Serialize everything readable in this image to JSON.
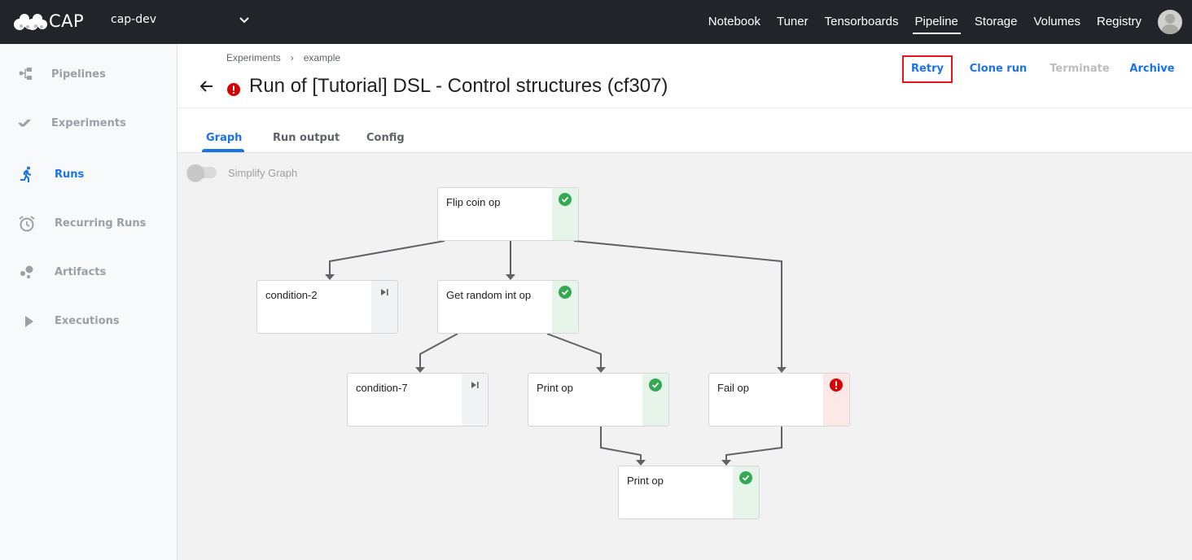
{
  "app": {
    "brand": "CAP",
    "namespace": "cap-dev",
    "nav": [
      {
        "label": "Notebook",
        "active": false
      },
      {
        "label": "Tuner",
        "active": false
      },
      {
        "label": "Tensorboards",
        "active": false
      },
      {
        "label": "Pipeline",
        "active": true
      },
      {
        "label": "Storage",
        "active": false
      },
      {
        "label": "Volumes",
        "active": false
      },
      {
        "label": "Registry",
        "active": false
      }
    ]
  },
  "sidebar": {
    "items": [
      {
        "label": "Pipelines",
        "icon": "pipelines-icon",
        "active": false
      },
      {
        "label": "Experiments",
        "icon": "experiments-icon",
        "active": false
      },
      {
        "label": "Runs",
        "icon": "runs-icon",
        "active": true
      },
      {
        "label": "Recurring Runs",
        "icon": "alarm-clock-icon",
        "active": false
      },
      {
        "label": "Artifacts",
        "icon": "artifacts-icon",
        "active": false
      },
      {
        "label": "Executions",
        "icon": "play-icon",
        "active": false
      }
    ]
  },
  "header": {
    "breadcrumb": [
      "Experiments",
      "example"
    ],
    "breadcrumb_separator": "›",
    "title": "Run of [Tutorial] DSL - Control structures (cf307)",
    "status": "error",
    "actions": [
      {
        "label": "Retry",
        "enabled": true,
        "highlighted": true
      },
      {
        "label": "Clone run",
        "enabled": true,
        "highlighted": false
      },
      {
        "label": "Terminate",
        "enabled": false,
        "highlighted": false
      },
      {
        "label": "Archive",
        "enabled": true,
        "highlighted": false
      }
    ]
  },
  "tabs": [
    {
      "label": "Graph",
      "active": true
    },
    {
      "label": "Run output",
      "active": false
    },
    {
      "label": "Config",
      "active": false
    }
  ],
  "graph": {
    "simplify_label": "Simplify Graph",
    "simplify_on": false,
    "nodes": [
      {
        "id": "flip",
        "label": "Flip coin op",
        "status": "succeeded"
      },
      {
        "id": "cond2",
        "label": "condition-2",
        "status": "skipped"
      },
      {
        "id": "getint",
        "label": "Get random int op",
        "status": "succeeded"
      },
      {
        "id": "cond7",
        "label": "condition-7",
        "status": "skipped"
      },
      {
        "id": "print1",
        "label": "Print op",
        "status": "succeeded"
      },
      {
        "id": "fail",
        "label": "Fail op",
        "status": "failed"
      },
      {
        "id": "print2",
        "label": "Print op",
        "status": "succeeded"
      }
    ],
    "edges": [
      [
        "flip",
        "cond2"
      ],
      [
        "flip",
        "getint"
      ],
      [
        "flip",
        "fail"
      ],
      [
        "getint",
        "cond7"
      ],
      [
        "getint",
        "print1"
      ],
      [
        "print1",
        "print2"
      ],
      [
        "fail",
        "print2"
      ]
    ]
  },
  "colors": {
    "accent": "#1a73e8",
    "success": "#34a853",
    "error": "#d50000",
    "topbar": "#212429",
    "highlight_box": "#e8141d"
  }
}
